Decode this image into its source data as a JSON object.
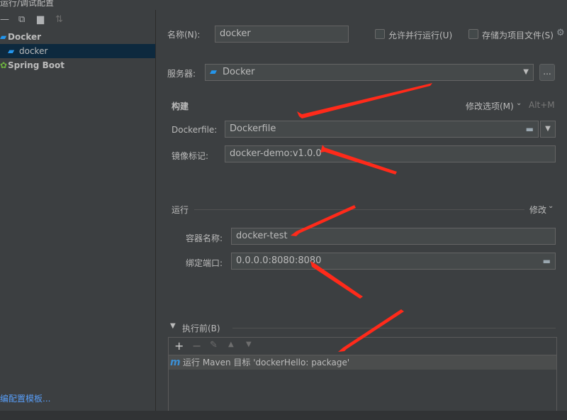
{
  "window": {
    "title": "运行/调试配置"
  },
  "left": {
    "tree": [
      {
        "label": "Docker",
        "bold": true
      },
      {
        "label": "docker",
        "selected": true
      },
      {
        "label": "Spring Boot",
        "bold": true
      }
    ],
    "templates_link": "编配置模板..."
  },
  "form": {
    "name_label": "名称(N):",
    "name_value": "docker",
    "allow_parallel": "允许并行运行(U)",
    "store_as_project": "存储为项目文件(S)",
    "server_label": "服务器:",
    "server_value": "Docker",
    "server_more": "...",
    "build": {
      "section": "构建",
      "modify": "修改选项(M)",
      "shortcut": "Alt+M",
      "dockerfile_label": "Dockerfile:",
      "dockerfile_value": "Dockerfile",
      "image_tag_label": "镜像标记:",
      "image_tag_value": "docker-demo:v1.0.0"
    },
    "run": {
      "section": "运行",
      "modify": "修改",
      "container_label": "容器名称:",
      "container_value": "docker-test",
      "ports_label": "绑定端口:",
      "ports_value": "0.0.0.0:8080:8080"
    },
    "before_launch": {
      "section": "执行前(B)",
      "task": "运行 Maven 目标 'dockerHello: package'"
    }
  },
  "colors": {
    "arrow": "#ff2a1a",
    "link": "#589df6",
    "selection": "#0d293e"
  }
}
